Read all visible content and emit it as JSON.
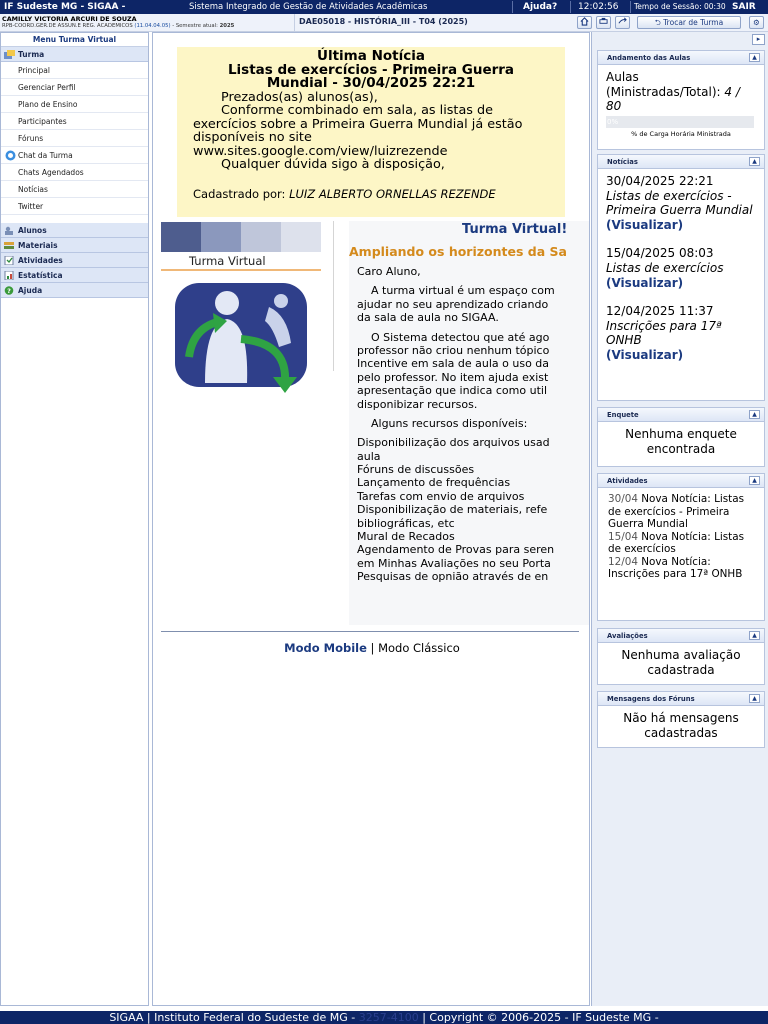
{
  "topbar": {
    "brand": "IF Sudeste MG - SIGAA -",
    "subtitle": "Sistema Integrado de Gestão de Atividades Acadêmicas",
    "help": "Ajuda?",
    "clock": "12:02:56",
    "session": "Tempo de Sessão: 00:30",
    "logout": "SAIR"
  },
  "user": {
    "name": "CAMILLY VICTORIA ARCURI DE SOUZA",
    "unit": "RPB-COORD.GER.DE ASSUN.E REG. ACADEMICOS",
    "unit_code": "(11.04.04.05)",
    "semester_label": "- Semestre atual:",
    "semester": "2025"
  },
  "course": {
    "title": "DAE05018 - HISTÓRIA_III - T04 (2025)",
    "switch_label": "Trocar de Turma"
  },
  "menu": {
    "title": "Menu Turma Virtual",
    "sections": [
      {
        "label": "Turma"
      },
      {
        "label": "Alunos"
      },
      {
        "label": "Materiais"
      },
      {
        "label": "Atividades"
      },
      {
        "label": "Estatística"
      },
      {
        "label": "Ajuda"
      }
    ],
    "turma_items": [
      "Principal",
      "Gerenciar Perfil",
      "Plano de Ensino",
      "Participantes",
      "Fóruns",
      "Chat da Turma",
      "Chats Agendados",
      "Notícias",
      "Twitter"
    ]
  },
  "news": {
    "heading": "Última Notícia",
    "title": "Listas de exercícios - Primeira Guerra Mundial - 30/04/2025 22:21",
    "greeting": "Prezados(as) alunos(as),",
    "body": "Conforme combinado em sala, as listas de exercícios sobre a Primeira Guerra Mundial já estão disponíveis no site www.sites.google.com/view/luizrezende",
    "closing": "Qualquer dúvida sigo à disposição,",
    "author_label": "Cadastrado por:",
    "author": "LUIZ ALBERTO ORNELLAS REZENDE"
  },
  "welcome": {
    "logo_text": "Turma Virtual",
    "title": "Turma Virtual!",
    "subtitle": "Ampliando os horizontes da Sa",
    "lines": [
      "Caro Aluno,",
      "",
      "    A turma virtual é um espaço com",
      "ajudar no seu aprendizado criando",
      "da sala de aula no SIGAA.",
      "",
      "    O Sistema detectou que até ago",
      "professor não criou nenhum tópico",
      "Incentive em sala de aula o uso da",
      "pelo professor. No item ajuda exist",
      "apresentação que indica como util",
      "disponibizar recursos.",
      "",
      "    Alguns recursos disponíveis:",
      "",
      "Disponibilização dos arquivos usad",
      "aula",
      "Fóruns de discussões",
      "Lançamento de frequências",
      "Tarefas com envio de arquivos",
      "Disponibilização de materiais, refe",
      "bibliográficas, etc",
      "Mural de Recados",
      "Agendamento de Provas para seren",
      "em Minhas Avaliações no seu Porta",
      "Pesquisas de opnião através de en"
    ]
  },
  "modes": {
    "mobile": "Modo Mobile",
    "separator": "|",
    "classic": "Modo Clássico"
  },
  "right": {
    "andamento": {
      "title": "Andamento das Aulas",
      "text": "Aulas (Ministradas/Total):",
      "value": "4 / 80",
      "percent_label": "0%",
      "progress": 0,
      "caption": "% de Carga Horária Ministrada"
    },
    "noticias": {
      "title": "Notícias",
      "items": [
        {
          "date": "30/04/2025 22:21",
          "title": "Listas de exercícios - Primeira Guerra Mundial",
          "link": "(Visualizar)"
        },
        {
          "date": "15/04/2025 08:03",
          "title": "Listas de exercícios",
          "link": "(Visualizar)"
        },
        {
          "date": "12/04/2025 11:37",
          "title": "Inscrições para 17ª ONHB",
          "link": "(Visualizar)"
        }
      ]
    },
    "enquete": {
      "title": "Enquete",
      "text": "Nenhuma enquete encontrada"
    },
    "atividades": {
      "title": "Atividades",
      "items": [
        {
          "date": "30/04",
          "text": "Nova Notícia: Listas de exercícios - Primeira Guerra Mundial"
        },
        {
          "date": "15/04",
          "text": "Nova Notícia: Listas de exercícios"
        },
        {
          "date": "12/04",
          "text": "Nova Notícia: Inscrições para 17ª ONHB"
        }
      ]
    },
    "avaliacoes": {
      "title": "Avaliações",
      "text": "Nenhuma avaliação cadastrada"
    },
    "foruns": {
      "title": "Mensagens dos Fóruns",
      "text": "Não há mensagens cadastradas"
    }
  },
  "footer": {
    "left": "SIGAA | Instituto Federal do Sudeste de MG -",
    "phone": "3257-4100",
    "right": "| Copyright © 2006-2025 - IF Sudeste MG -"
  },
  "colors": {
    "brand": "#0d2566",
    "accent": "#1b3a80",
    "news_bg": "#fdf6c6",
    "orange": "#d48a1c"
  }
}
